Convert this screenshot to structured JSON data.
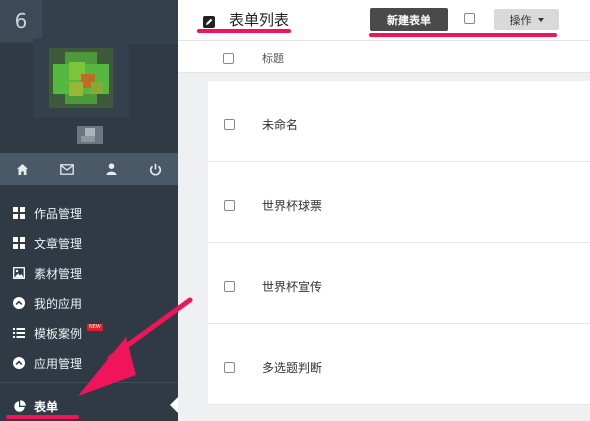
{
  "sidebar": {
    "logo": "6",
    "icon_bar": [
      "home-icon",
      "mail-icon",
      "user-icon",
      "power-icon"
    ],
    "items": [
      {
        "label": "作品管理",
        "icon": "grid-icon"
      },
      {
        "label": "文章管理",
        "icon": "grid-icon"
      },
      {
        "label": "素材管理",
        "icon": "image-icon"
      },
      {
        "label": "我的应用",
        "icon": "circle-up-icon"
      },
      {
        "label": "模板案例",
        "icon": "list-icon",
        "badge": "NEW"
      },
      {
        "label": "应用管理",
        "icon": "circle-up-icon"
      }
    ],
    "active_item": {
      "label": "表单",
      "icon": "pie-chart-icon"
    }
  },
  "header": {
    "title": "表单列表",
    "new_button": "新建表单",
    "ops_button": "操作"
  },
  "table": {
    "column_title": "标题",
    "rows": [
      "未命名",
      "世界杯球票",
      "世界杯宣传",
      "多选题判断"
    ]
  },
  "colors": {
    "sidebar_bg": "#2f3a44",
    "annotation": "#f0145a",
    "new_button_bg": "#4a4a4a"
  }
}
